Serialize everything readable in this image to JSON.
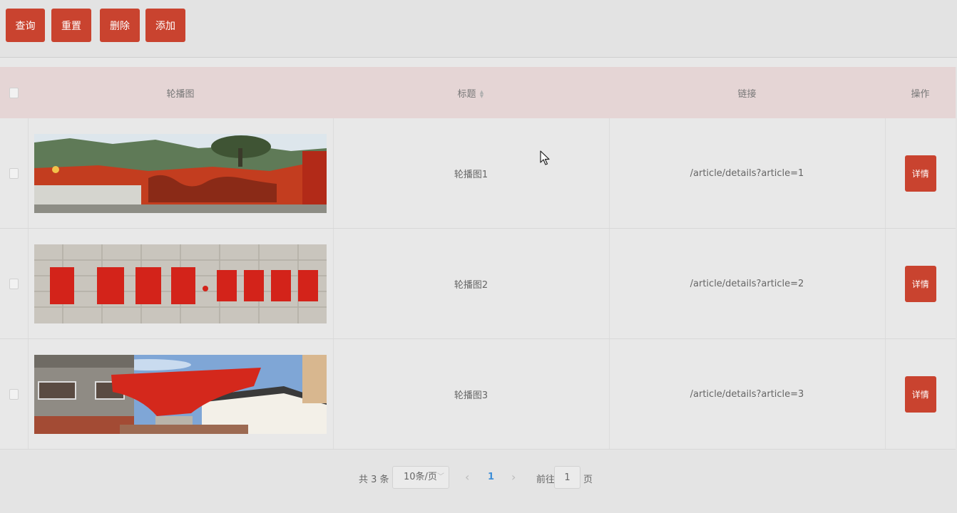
{
  "toolbar": {
    "query_label": "查询",
    "reset_label": "重置",
    "delete_label": "删除",
    "add_label": "添加"
  },
  "table": {
    "headers": {
      "image": "轮播图",
      "title": "标题",
      "link": "链接",
      "action": "操作"
    },
    "rows": [
      {
        "title": "轮播图1",
        "link": "/article/details?article=1",
        "action_label": "详情"
      },
      {
        "title": "轮播图2",
        "link": "/article/details?article=2",
        "action_label": "详情"
      },
      {
        "title": "轮播图3",
        "link": "/article/details?article=3",
        "action_label": "详情"
      }
    ]
  },
  "pagination": {
    "total_text": "共 3 条",
    "page_size": "10条/页",
    "current_page": "1",
    "goto_label": "前往",
    "goto_value": "1",
    "page_suffix": "页"
  },
  "colors": {
    "accent": "#c9432f",
    "header_bg": "#e5d5d5",
    "page_active": "#3f8fd8"
  }
}
